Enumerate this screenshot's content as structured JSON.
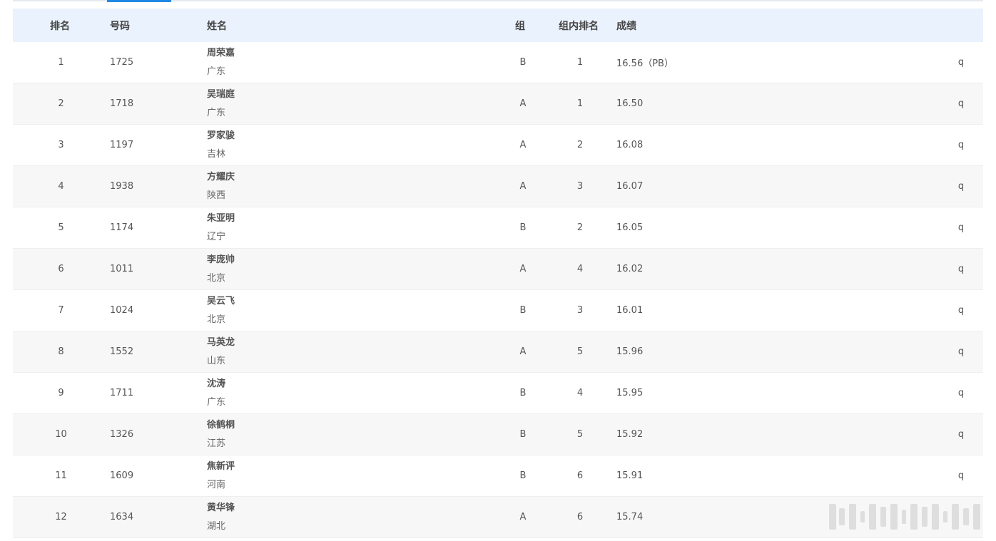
{
  "table": {
    "columns": {
      "rank": "排名",
      "bib": "号码",
      "name": "姓名",
      "group": "组",
      "group_rank": "组内排名",
      "result": "成绩"
    },
    "rows": [
      {
        "rank": "1",
        "bib": "1725",
        "name": "周荣嘉",
        "team": "广东",
        "group": "B",
        "group_rank": "1",
        "result": "16.56（PB）",
        "q": "q"
      },
      {
        "rank": "2",
        "bib": "1718",
        "name": "吴瑞庭",
        "team": "广东",
        "group": "A",
        "group_rank": "1",
        "result": "16.50",
        "q": "q"
      },
      {
        "rank": "3",
        "bib": "1197",
        "name": "罗家骏",
        "team": "吉林",
        "group": "A",
        "group_rank": "2",
        "result": "16.08",
        "q": "q"
      },
      {
        "rank": "4",
        "bib": "1938",
        "name": "方耀庆",
        "team": "陕西",
        "group": "A",
        "group_rank": "3",
        "result": "16.07",
        "q": "q"
      },
      {
        "rank": "5",
        "bib": "1174",
        "name": "朱亚明",
        "team": "辽宁",
        "group": "B",
        "group_rank": "2",
        "result": "16.05",
        "q": "q"
      },
      {
        "rank": "6",
        "bib": "1011",
        "name": "李庞帅",
        "team": "北京",
        "group": "A",
        "group_rank": "4",
        "result": "16.02",
        "q": "q"
      },
      {
        "rank": "7",
        "bib": "1024",
        "name": "吴云飞",
        "team": "北京",
        "group": "B",
        "group_rank": "3",
        "result": "16.01",
        "q": "q"
      },
      {
        "rank": "8",
        "bib": "1552",
        "name": "马英龙",
        "team": "山东",
        "group": "A",
        "group_rank": "5",
        "result": "15.96",
        "q": "q"
      },
      {
        "rank": "9",
        "bib": "1711",
        "name": "沈涛",
        "team": "广东",
        "group": "B",
        "group_rank": "4",
        "result": "15.95",
        "q": "q"
      },
      {
        "rank": "10",
        "bib": "1326",
        "name": "徐鹤桐",
        "team": "江苏",
        "group": "B",
        "group_rank": "5",
        "result": "15.92",
        "q": "q"
      },
      {
        "rank": "11",
        "bib": "1609",
        "name": "焦新评",
        "team": "河南",
        "group": "B",
        "group_rank": "6",
        "result": "15.91",
        "q": "q"
      },
      {
        "rank": "12",
        "bib": "1634",
        "name": "黄华锋",
        "team": "湖北",
        "group": "A",
        "group_rank": "6",
        "result": "15.74",
        "q": ""
      }
    ]
  },
  "colors": {
    "header_bg": "#eaf2fd",
    "alt_row_bg": "#f7f7f7",
    "tab_accent": "#1e88e5"
  }
}
